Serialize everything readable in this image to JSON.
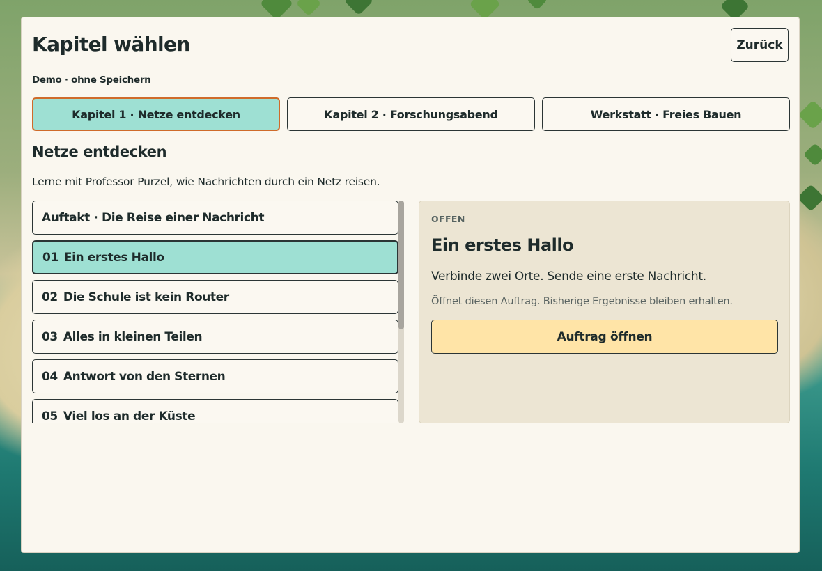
{
  "header": {
    "title": "Kapitel wählen",
    "back_label": "Zurück",
    "demo_note": "Demo · ohne Speichern"
  },
  "chapters": [
    {
      "label": "Kapitel 1 · Netze entdecken",
      "selected": true
    },
    {
      "label": "Kapitel 2 · Forschungsabend",
      "selected": false
    },
    {
      "label": "Werkstatt · Freies Bauen",
      "selected": false
    }
  ],
  "section": {
    "title": "Netze entdecken",
    "description": "Lerne mit Professor Purzel, wie Nachrichten durch ein Netz reisen."
  },
  "missions": [
    {
      "number": "",
      "label": "Auftakt · Die Reise einer Nachricht",
      "selected": false
    },
    {
      "number": "01",
      "label": "Ein erstes Hallo",
      "selected": true
    },
    {
      "number": "02",
      "label": "Die Schule ist kein Router",
      "selected": false
    },
    {
      "number": "03",
      "label": "Alles in kleinen Teilen",
      "selected": false
    },
    {
      "number": "04",
      "label": "Antwort von den Sternen",
      "selected": false
    },
    {
      "number": "05",
      "label": "Viel los an der Küste",
      "selected": false
    }
  ],
  "detail": {
    "status": "OFFEN",
    "title": "Ein erstes Hallo",
    "description": "Verbinde zwei Orte. Sende eine erste Nachricht.",
    "hint": "Öffnet diesen Auftrag. Bisherige Ergebnisse bleiben erhalten.",
    "open_label": "Auftrag öffnen"
  },
  "colors": {
    "panel_bg": "#faf7ef",
    "selected_bg": "#9ee0d3",
    "selected_tab_border": "#cf6b2a",
    "primary_button_bg": "#ffe4a7",
    "detail_card_bg": "#ece5d3"
  }
}
